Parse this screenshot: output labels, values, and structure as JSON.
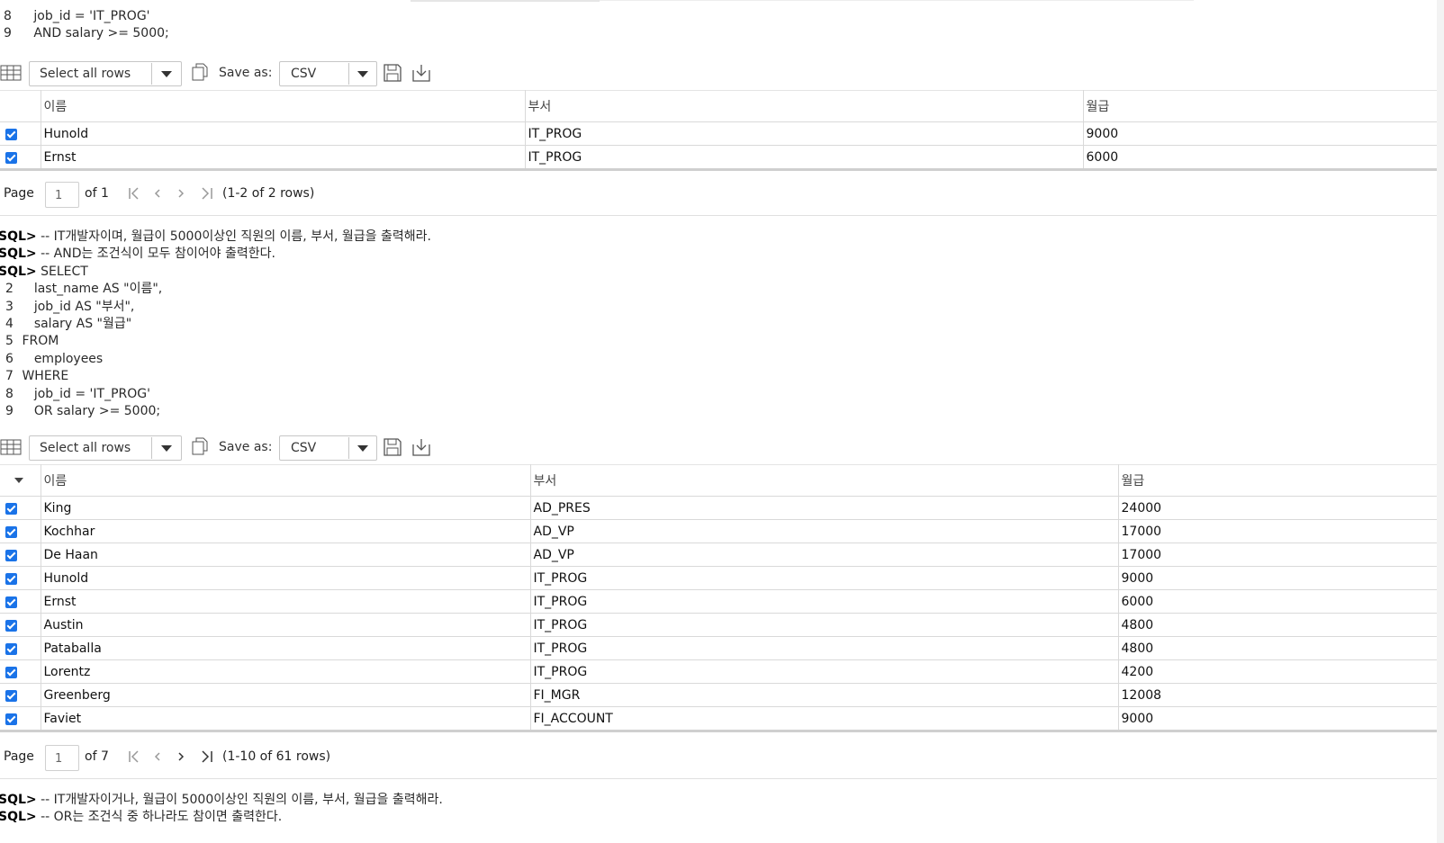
{
  "query1": {
    "lines": [
      {
        "no": "8",
        "text": "job_id = 'IT_PROG'"
      },
      {
        "no": "9",
        "text": "AND salary >= 5000;"
      }
    ]
  },
  "toolbar": {
    "select_all_label": "Select all rows",
    "save_as_label": "Save as:",
    "format_value": "CSV"
  },
  "grid1": {
    "columns": [
      "이름",
      "부서",
      "월급"
    ],
    "rows": [
      [
        "Hunold",
        "IT_PROG",
        "9000"
      ],
      [
        "Ernst",
        "IT_PROG",
        "6000"
      ]
    ],
    "pager": {
      "page_label": "Page",
      "page_value": "1",
      "of_label": "of 1",
      "rows_label": "(1-2 of 2 rows)"
    }
  },
  "query2": {
    "prompt": "SQL>",
    "comments": [
      "-- IT개발자이며, 월급이 5000이상인 직원의 이름, 부서, 월급을 출력해라.",
      "-- AND는 조건식이 모두 참이어야 출력한다."
    ],
    "first_line": "SELECT",
    "lines": [
      {
        "no": "2",
        "text": "last_name AS \"이름\","
      },
      {
        "no": "3",
        "text": "job_id AS \"부서\","
      },
      {
        "no": "4",
        "text": "salary AS \"월급\""
      },
      {
        "no": "5",
        "text": "FROM"
      },
      {
        "no": "6",
        "text": "employees"
      },
      {
        "no": "7",
        "text": "WHERE"
      },
      {
        "no": "8",
        "text": "job_id = 'IT_PROG'"
      },
      {
        "no": "9",
        "text": "OR salary >= 5000;"
      }
    ]
  },
  "grid2": {
    "columns": [
      "이름",
      "부서",
      "월급"
    ],
    "rows": [
      [
        "King",
        "AD_PRES",
        "24000"
      ],
      [
        "Kochhar",
        "AD_VP",
        "17000"
      ],
      [
        "De Haan",
        "AD_VP",
        "17000"
      ],
      [
        "Hunold",
        "IT_PROG",
        "9000"
      ],
      [
        "Ernst",
        "IT_PROG",
        "6000"
      ],
      [
        "Austin",
        "IT_PROG",
        "4800"
      ],
      [
        "Pataballa",
        "IT_PROG",
        "4800"
      ],
      [
        "Lorentz",
        "IT_PROG",
        "4200"
      ],
      [
        "Greenberg",
        "FI_MGR",
        "12008"
      ],
      [
        "Faviet",
        "FI_ACCOUNT",
        "9000"
      ]
    ],
    "pager": {
      "page_label": "Page",
      "page_value": "1",
      "of_label": "of 7",
      "rows_label": "(1-10 of 61 rows)"
    }
  },
  "query3": {
    "prompt": "SQL>",
    "comments": [
      "-- IT개발자이거나, 월급이 5000이상인 직원의 이름, 부서, 월급을 출력해라.",
      "-- OR는 조건식 중 하나라도 참이면 출력한다."
    ]
  },
  "colors": {
    "checkbox": "#1a73e8",
    "border": "#d9d9d9"
  }
}
